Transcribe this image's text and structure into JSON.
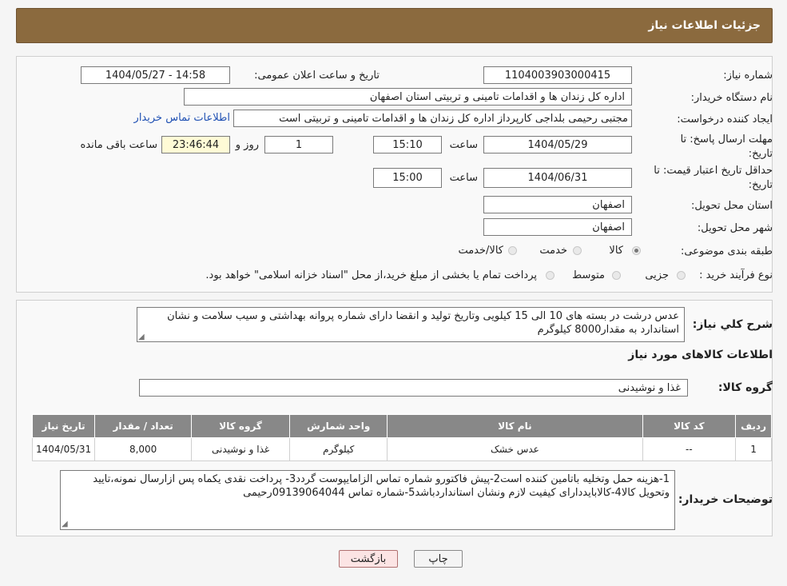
{
  "header": {
    "title": "جزئیات اطلاعات نیاز"
  },
  "details": {
    "need_number_label": "شماره نیاز:",
    "need_number": "1104003903000415",
    "announce_label": "تاریخ و ساعت اعلان عمومی:",
    "announce_value": "1404/05/27 - 14:58",
    "buyer_org_label": "نام دستگاه خریدار:",
    "buyer_org": "اداره کل زندان ها و اقدامات تامینی و تربیتی استان اصفهان",
    "creator_label": "ایجاد کننده درخواست:",
    "creator": "مجتبی رحیمی بلداجی کارپرداز اداره کل زندان ها و اقدامات تامینی و تربیتی است",
    "contact_link": "اطلاعات تماس خریدار",
    "deadline_label_1": "مهلت ارسال پاسخ: تا",
    "deadline_label_2": "تاریخ:",
    "deadline_date": "1404/05/29",
    "time_label": "ساعت",
    "deadline_time": "15:10",
    "days_value": "1",
    "days_label": "روز و",
    "remaining_value": "23:46:44",
    "remaining_label": "ساعت باقی مانده",
    "validity_label_1": "حداقل تاریخ اعتبار قیمت: تا",
    "validity_label_2": "تاریخ:",
    "validity_date": "1404/06/31",
    "validity_time_label": "ساعت",
    "validity_time": "15:00",
    "province_label": "استان محل تحویل:",
    "province": "اصفهان",
    "city_label": "شهر محل تحویل:",
    "city": "اصفهان",
    "category_label": "طبقه بندی موضوعی:",
    "category_options": [
      "کالا",
      "خدمت",
      "کالا/خدمت"
    ],
    "category_selected": "کالا",
    "process_label": "نوع فرآیند خرید :",
    "process_options": [
      "جزیی",
      "متوسط"
    ],
    "process_note": "پرداخت تمام یا بخشی از مبلغ خرید،از محل \"اسناد خزانه اسلامی\" خواهد بود."
  },
  "summary": {
    "label": "شرح كلي نياز:",
    "text": "عدس درشت  در بسته های 10 الی 15  کیلویی وتاریخ تولید و انقضا  دارای شماره پروانه بهداشتی و سیب سلامت و نشان استاندارد به مقدار8000 کیلوگرم"
  },
  "goods": {
    "section_title": "اطلاعات کالاهای مورد نیاز",
    "group_label": "گروه کالا:",
    "group_value": "غذا و نوشیدنی",
    "table": {
      "headers": [
        "ردیف",
        "کد کالا",
        "نام کالا",
        "واحد شمارش",
        "گروه کالا",
        "تعداد / مقدار",
        "تاریخ نیاز"
      ],
      "rows": [
        [
          "1",
          "--",
          "عدس خشک",
          "کیلوگرم",
          "غذا و نوشیدنی",
          "8,000",
          "1404/05/31"
        ]
      ]
    }
  },
  "notes": {
    "label": "توضیحات خریدار:",
    "text": "1-هزینه حمل وتخلیه باتامین کننده است2-پیش فاکتورو شماره تماس الزامایپوست گردد3- پرداخت نقدی یکماه  پس ازارسال نمونه،تایید وتحویل کالا4-کالاباید‌دارای کیفیت لازم ونشان استانداردباشد5-شماره تماس 09139064044رحیمی"
  },
  "buttons": {
    "print": "چاپ",
    "back": "بازگشت"
  },
  "colors": {
    "header_bg": "#8b6a3e",
    "table_header_bg": "#888888",
    "link": "#2051b3",
    "remaining_bg": "#fffbd6"
  }
}
